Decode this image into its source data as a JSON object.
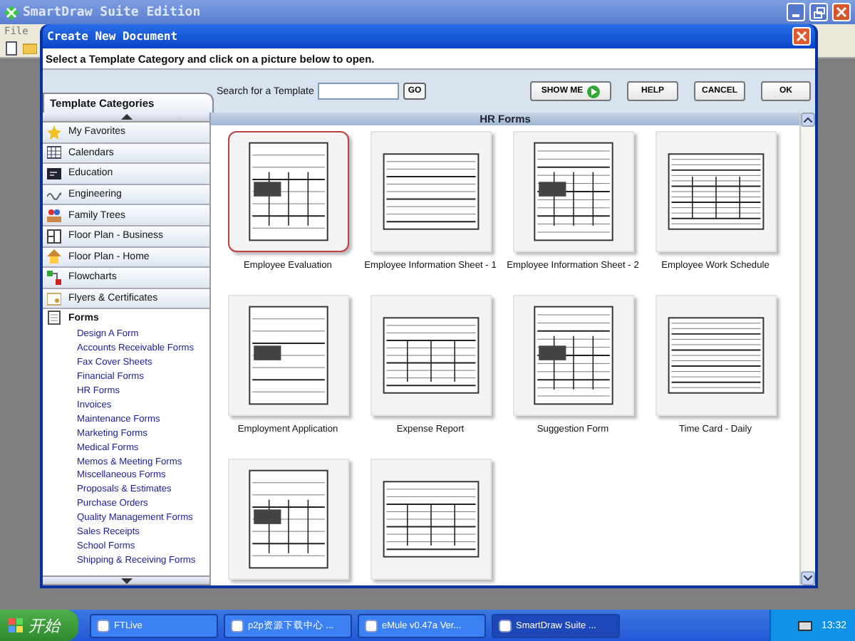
{
  "app": {
    "title": "SmartDraw Suite Edition",
    "menu": [
      "File"
    ]
  },
  "dialog": {
    "title": "Create New Document",
    "instruction": "Select a Template Category and click on a picture below to open.",
    "categories_tab": "Template Categories",
    "search": {
      "label": "Search for a Template",
      "go": "GO"
    },
    "buttons": [
      {
        "label": "SHOW ME",
        "kind": "arrow"
      },
      {
        "label": "HELP",
        "kind": "plain"
      },
      {
        "label": "CANCEL",
        "kind": "plain"
      },
      {
        "label": "OK",
        "kind": "plain"
      }
    ],
    "categories": [
      {
        "label": "My Favorites",
        "expanded": false
      },
      {
        "label": "Calendars",
        "expanded": false
      },
      {
        "label": "Education",
        "expanded": false
      },
      {
        "label": "Engineering",
        "expanded": false
      },
      {
        "label": "Family Trees",
        "expanded": false
      },
      {
        "label": "Floor Plan - Business",
        "expanded": false
      },
      {
        "label": "Floor Plan - Home",
        "expanded": false
      },
      {
        "label": "Flowcharts",
        "expanded": false
      },
      {
        "label": "Flyers & Certificates",
        "expanded": false
      },
      {
        "label": "Forms",
        "expanded": true,
        "children": [
          {
            "label": "Design A Form"
          },
          {
            "label": "Accounts Receivable Forms"
          },
          {
            "label": "Fax Cover Sheets"
          },
          {
            "label": "Financial Forms"
          },
          {
            "label": "HR Forms"
          },
          {
            "label": "Invoices"
          },
          {
            "label": "Maintenance Forms"
          },
          {
            "label": "Marketing Forms"
          },
          {
            "label": "Medical Forms"
          },
          {
            "label": "Memos & Meeting Forms"
          },
          {
            "label": "Miscellaneous Forms"
          },
          {
            "label": "Proposals & Estimates"
          },
          {
            "label": "Purchase Orders"
          },
          {
            "label": "Quality Management Forms"
          },
          {
            "label": "Sales Receipts"
          },
          {
            "label": "School Forms"
          },
          {
            "label": "Shipping & Receiving Forms"
          }
        ]
      }
    ],
    "gallery": {
      "title": "HR Forms",
      "templates": [
        {
          "label": "Employee Evaluation",
          "selected": true
        },
        {
          "label": "Employee Information Sheet - 1",
          "selected": false
        },
        {
          "label": "Employee Information Sheet - 2",
          "selected": false
        },
        {
          "label": "Employee Work Schedule",
          "selected": false
        },
        {
          "label": "Employment Application",
          "selected": false
        },
        {
          "label": "Expense Report",
          "selected": false
        },
        {
          "label": "Suggestion Form",
          "selected": false
        },
        {
          "label": "Time Card - Daily",
          "selected": false
        },
        {
          "selected": false
        },
        {
          "selected": false
        }
      ]
    }
  },
  "taskbar": {
    "start": "开始",
    "tasks": [
      {
        "label": "FTLive",
        "selected": false
      },
      {
        "label": "p2p资源下载中心 ...",
        "selected": false
      },
      {
        "label": "eMule v0.47a Ver...",
        "selected": false
      },
      {
        "label": "SmartDraw Suite ...",
        "selected": true
      }
    ],
    "clock": "13:32"
  }
}
